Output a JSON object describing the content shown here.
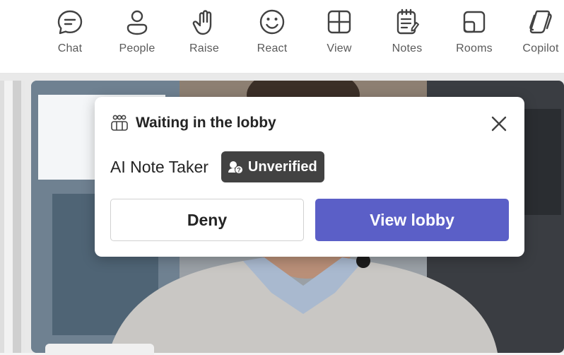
{
  "toolbar": {
    "items": [
      {
        "label": "Chat",
        "icon": "chat-icon"
      },
      {
        "label": "People",
        "icon": "people-icon"
      },
      {
        "label": "Raise",
        "icon": "raise-hand-icon"
      },
      {
        "label": "React",
        "icon": "react-smiley-icon"
      },
      {
        "label": "View",
        "icon": "view-grid-icon"
      },
      {
        "label": "Notes",
        "icon": "notes-icon"
      },
      {
        "label": "Rooms",
        "icon": "rooms-icon"
      },
      {
        "label": "Copilot",
        "icon": "copilot-icon"
      }
    ]
  },
  "lobby_notice": {
    "title": "Waiting in the lobby",
    "icon": "lobby-people-icon",
    "close_icon": "close-icon",
    "participant_name": "AI Note Taker",
    "badge_label": "Unverified",
    "badge_icon": "unverified-shield-icon",
    "deny_label": "Deny",
    "view_lobby_label": "View lobby"
  },
  "colors": {
    "accent": "#5b5fc7",
    "badge_bg": "#424242",
    "toolbar_bg": "#ffffff"
  }
}
